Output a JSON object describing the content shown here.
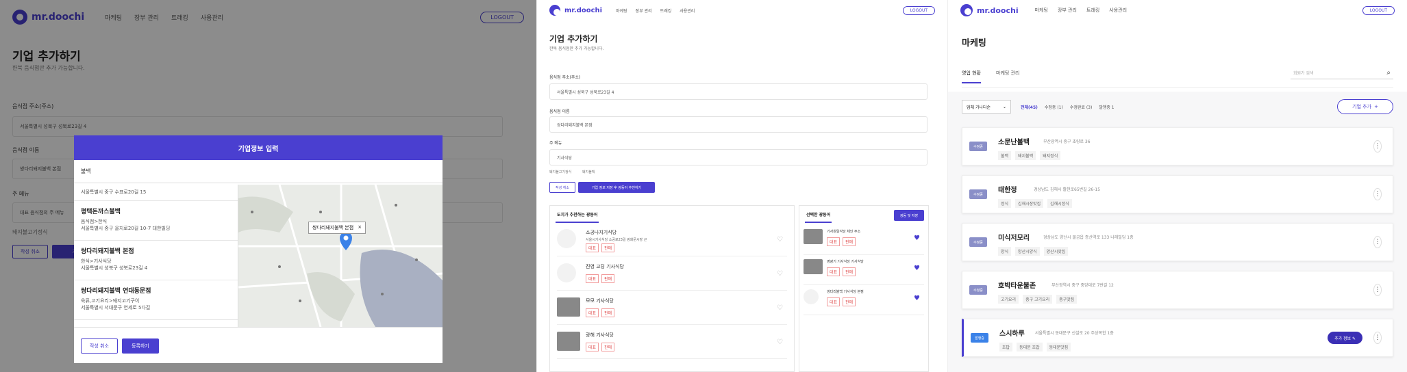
{
  "nav": {
    "brand": "mr.doochi",
    "menu": [
      "마케팅",
      "장부 관리",
      "트래킹",
      "사용관리"
    ],
    "logout": "LOGOUT"
  },
  "add_company": {
    "title": "기업 추가하기",
    "subtitle": "한북 음식점만 추가 가능합니다.",
    "address_label": "음식점 주소(주소)",
    "address_value": "서울특별시 성북구 성북로23길 4",
    "name_label": "음식점 이름",
    "name_value": "쌍다리돼지불백 본점",
    "menu_label": "주 메뉴",
    "menu_value": "대표 음식점의 주 메뉴",
    "menu_hints": [
      "돼지불고기정식",
      "돼지불백"
    ],
    "btn_cancel": "작성 취소",
    "btn_next": "기업 정보 저장 후 광동어 추천하기"
  },
  "modal": {
    "title": "기업정보 입력",
    "search_value": "불백",
    "results": [
      {
        "name": "",
        "category": "",
        "address": "서울특별시 중구 수표로20길 15"
      },
      {
        "name": "평택돈까스불백",
        "category": "음식점>한식",
        "address": "서울특별시 중구 을지로20길 10-7 대한빌딩"
      },
      {
        "name": "쌍다리돼지불백 본점",
        "category": "한식>기사식당",
        "address": "서울특별시 성북구 성북로23길 4"
      },
      {
        "name": "쌍다리돼지불백 연대동문점",
        "category": "육류,고기요리>돼지고기구이",
        "address": "서울특별시 서대문구 연세로 5다길"
      }
    ],
    "map_popup": "쌍다리돼지불백 본점",
    "map_close": "×",
    "btn_cancel": "작성 취소",
    "btn_submit": "등록하기"
  },
  "add_company_2": {
    "title": "기업 추가하기",
    "subtitle": "한북 음식점만 추가 가능합니다.",
    "address_label": "음식점 주소(주소)",
    "address_value": "서울특별시 성북구 성북로23길 4",
    "name_label": "음식점 이름",
    "name_value": "쌍다리돼지불백 본점",
    "menu_label": "주 메뉴",
    "menu_value": "기사식당",
    "menu_hints": [
      "돼지불고기정식",
      "돼지불백"
    ],
    "btn_cancel": "작성 취소",
    "btn_next": "기업 정보 저장 후 광동어 추천하기",
    "rec_title": "도치가 추천하는 광동어",
    "sel_title": "선택한 광동어",
    "sel_btn": "광동 및 저장",
    "recs": [
      {
        "name": "소공나지기식당",
        "sub": "서울시기사식당 소공로23길 광화문시장 근",
        "tags": [
          "대표",
          "판매"
        ],
        "photo": false
      },
      {
        "name": "진영 고딩 기사식당",
        "sub": "",
        "tags": [
          "대표",
          "판매"
        ],
        "photo": false
      },
      {
        "name": "모모 기사식당",
        "sub": "",
        "tags": [
          "대표",
          "판매"
        ],
        "photo": true
      },
      {
        "name": "광해 기사식당",
        "sub": "",
        "tags": [
          "대표",
          "판매"
        ],
        "photo": true
      }
    ],
    "selected": [
      {
        "name": "기사원일식당 체인 주소",
        "tags": [
          "대표",
          "판매"
        ],
        "photo": true
      },
      {
        "name": "영광기 기사식당 기사식당",
        "tags": [
          "대표",
          "판매"
        ],
        "photo": true
      },
      {
        "name": "쌍다리불백 기사식당 본점",
        "tags": [
          "대표",
          "판매"
        ],
        "photo": false
      }
    ]
  },
  "marketing": {
    "title": "마케팅",
    "tabs": [
      "영업 현황",
      "마케팅 관리"
    ],
    "search_placeholder": "회원가 검색",
    "sort": "업체 가나다순",
    "filters": [
      "전체(45)",
      "수정중 (1)",
      "수정완료 (3)",
      "발행중 1"
    ],
    "add_btn": "기업 추가",
    "companies": [
      {
        "badge": "수정중",
        "name": "소문난불백",
        "addr": "부산광역시 중구 초량로 36",
        "tags": [
          "불백",
          "돼지불백",
          "돼지정식"
        ],
        "action": ""
      },
      {
        "badge": "수정중",
        "name": "태한정",
        "addr": "경상남도 김해시 활천로65번길 26-15",
        "tags": [
          "정식",
          "김해시장맛집",
          "김해시정식"
        ],
        "action": ""
      },
      {
        "badge": "수정중",
        "name": "미식저모리",
        "addr": "경상남도 양산시 물금읍 증산역로 133 나래빌딩 1층",
        "tags": [
          "양식",
          "양산시양식",
          "양산시맛집"
        ],
        "action": ""
      },
      {
        "badge": "수정중",
        "name": "호박타운불존",
        "addr": "부산광역시 중구 중앙대로 7번길 12",
        "tags": [
          "고기요리",
          "중구 고기요리",
          "중구맛집"
        ],
        "action": ""
      },
      {
        "badge": "발행중",
        "name": "스시하루",
        "addr": "서울특별시 동대문구 신설로 20 주상복합 1층",
        "tags": [
          "초밥",
          "동대문 초밥",
          "동대문맛집"
        ],
        "action": "추가 정보 ✎"
      }
    ]
  },
  "colors": {
    "accent": "#4a3fd0",
    "badge": "#8a8fc8",
    "tag_red": "#e05050"
  }
}
